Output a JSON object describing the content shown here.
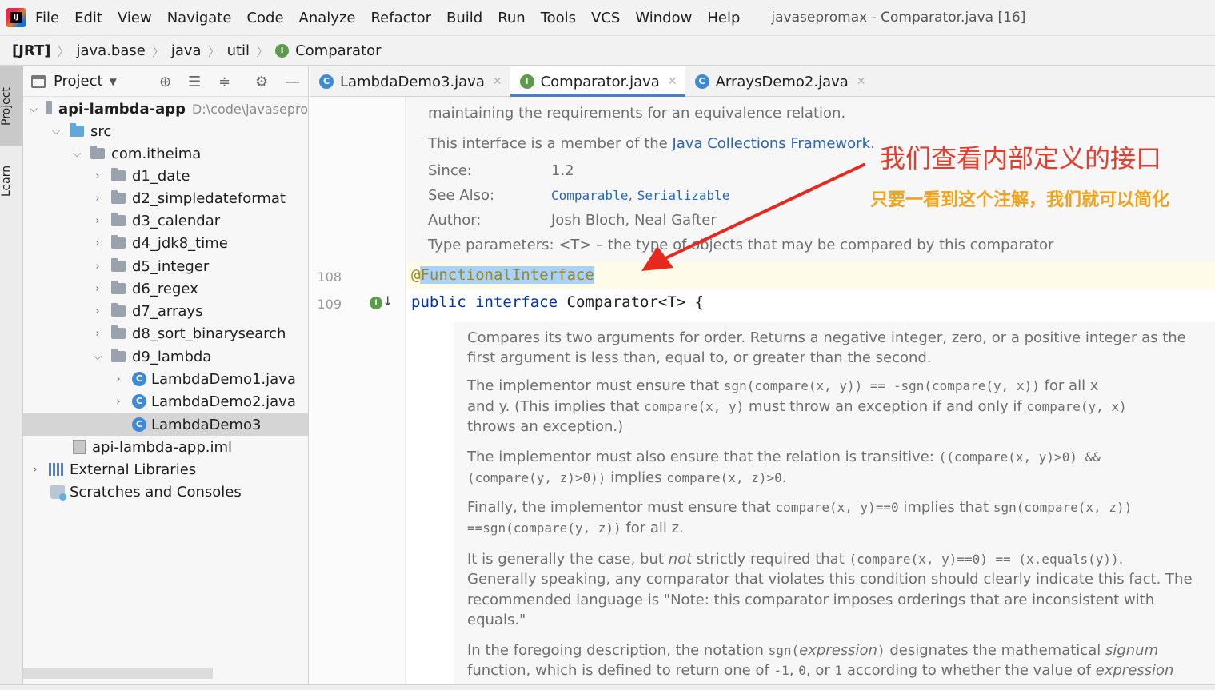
{
  "menubar": {
    "items": [
      "File",
      "Edit",
      "View",
      "Navigate",
      "Code",
      "Analyze",
      "Refactor",
      "Build",
      "Run",
      "Tools",
      "VCS",
      "Window",
      "Help"
    ],
    "window_title": "javasepromax - Comparator.java [16]"
  },
  "breadcrumb": {
    "items": [
      "[JRT]",
      "java.base",
      "java",
      "util",
      "Comparator"
    ]
  },
  "tool_stripe": {
    "project_label": "Project",
    "learn_label": "Learn"
  },
  "project_panel": {
    "title": "Project",
    "tree": [
      {
        "label": "api-lambda-app",
        "hint": "D:\\code\\javasepro",
        "icon": "module-folder",
        "expanded": true
      },
      {
        "label": "src",
        "icon": "source-folder",
        "expanded": true
      },
      {
        "label": "com.itheima",
        "icon": "package-folder",
        "expanded": true
      },
      {
        "label": "d1_date",
        "icon": "package-folder",
        "expanded": false
      },
      {
        "label": "d2_simpledateformat",
        "icon": "package-folder",
        "expanded": false
      },
      {
        "label": "d3_calendar",
        "icon": "package-folder",
        "expanded": false
      },
      {
        "label": "d4_jdk8_time",
        "icon": "package-folder",
        "expanded": false
      },
      {
        "label": "d5_integer",
        "icon": "package-folder",
        "expanded": false
      },
      {
        "label": "d6_regex",
        "icon": "package-folder",
        "expanded": false
      },
      {
        "label": "d7_arrays",
        "icon": "package-folder",
        "expanded": false
      },
      {
        "label": "d8_sort_binarysearch",
        "icon": "package-folder",
        "expanded": false
      },
      {
        "label": "d9_lambda",
        "icon": "package-folder",
        "expanded": true
      },
      {
        "label": "LambdaDemo1.java",
        "icon": "java-class",
        "expanded": false
      },
      {
        "label": "LambdaDemo2.java",
        "icon": "java-class",
        "expanded": false
      },
      {
        "label": "LambdaDemo3",
        "icon": "java-class",
        "selected": true
      },
      {
        "label": "api-lambda-app.iml",
        "icon": "iml-file"
      },
      {
        "label": "External Libraries",
        "icon": "library",
        "expanded": false
      },
      {
        "label": "Scratches and Consoles",
        "icon": "scratches"
      }
    ]
  },
  "editor": {
    "tabs": [
      {
        "label": "LambdaDemo3.java",
        "icon": "java-class",
        "active": false
      },
      {
        "label": "Comparator.java",
        "icon": "java-interface",
        "active": true
      },
      {
        "label": "ArraysDemo2.java",
        "icon": "java-class",
        "active": false
      }
    ],
    "doc_top": {
      "line1": "maintaining the requirements for an equivalence relation.",
      "member_prefix": "This interface is a member of the ",
      "member_link": "Java Collections Framework",
      "member_suffix": ".",
      "since_label": "Since:",
      "since_value": "1.2",
      "see_also_label": "See Also:",
      "see_also_1": "Comparable",
      "see_also_sep": ", ",
      "see_also_2": "Serializable",
      "author_label": "Author:",
      "author_value": "Josh Bloch, Neal Gafter",
      "type_params_label": "Type parameters:",
      "type_params_value": "<T> – the type of objects that may be compared by this comparator"
    },
    "line_numbers": [
      "108",
      "109"
    ],
    "code": {
      "annotation_at": "@",
      "annotation_name": "FunctionalInterface",
      "kw_public": "public",
      "kw_interface": "interface",
      "decl_rest": "Comparator<T> {"
    },
    "doc_method": {
      "p1_l1": "Compares its two arguments for order. Returns a negative integer, zero, or a positive integer as the",
      "p1_l2": "first argument is less than, equal to, or greater than the second.",
      "p2_l1a": "The implementor must ensure that ",
      "p2_l1b": "sgn(compare(x, y)) == -sgn(compare(y, x))",
      "p2_l1c": " for all x",
      "p2_l2a": "and y. (This implies that ",
      "p2_l2b": "compare(x, y)",
      "p2_l2c": " must throw an exception if and only if ",
      "p2_l2d": "compare(y, x)",
      "p2_l3": "throws an exception.)",
      "p3_l1a": "The implementor must also ensure that the relation is transitive: ",
      "p3_l1b": "((compare(x, y)>0) &&",
      "p3_l2a": "(compare(y, z)>0))",
      "p3_l2b": " implies ",
      "p3_l2c": "compare(x, z)>0",
      "p3_l2d": ".",
      "p4_l1a": "Finally, the implementor must ensure that ",
      "p4_l1b": "compare(x, y)==0",
      "p4_l1c": " implies that ",
      "p4_l1d": "sgn(compare(x, z))",
      "p4_l2a": "==sgn(compare(y, z))",
      "p4_l2b": " for all z.",
      "p5_l1a": "It is generally the case, but ",
      "p5_l1b": "not",
      "p5_l1c": " strictly required that ",
      "p5_l1d": "(compare(x, y)==0) == (x.equals(y))",
      "p5_l1e": ".",
      "p5_l2": "Generally speaking, any comparator that violates this condition should clearly indicate this fact. The",
      "p5_l3": "recommended language is \"Note: this comparator imposes orderings that are inconsistent with",
      "p5_l4": "equals.\"",
      "p6_l1a": "In the foregoing description, the notation ",
      "p6_l1b": "sgn(",
      "p6_l1c": "expression",
      "p6_l1d": ")",
      "p6_l1e": " designates the mathematical ",
      "p6_l1f": "signum",
      "p6_l2a": "function, which is defined to return one of ",
      "p6_l2b": "-1",
      "p6_l2c": ", ",
      "p6_l2d": "0",
      "p6_l2e": ", or ",
      "p6_l2f": "1",
      "p6_l2g": " according to whether the value of ",
      "p6_l2h": "expression"
    }
  },
  "overlay": {
    "title": "我们查看内部定义的接口",
    "subtitle": "只要一看到这个注解，我们就可以简化",
    "colors": {
      "title": "#e83b2c",
      "subtitle": "#f0a21b",
      "arrow": "#e8281c"
    }
  },
  "colors": {
    "accent": "#4083c9",
    "keyword": "#0033b3",
    "annotation": "#9e880d",
    "selection": "#a8d1ff",
    "link": "#2a64b8"
  }
}
